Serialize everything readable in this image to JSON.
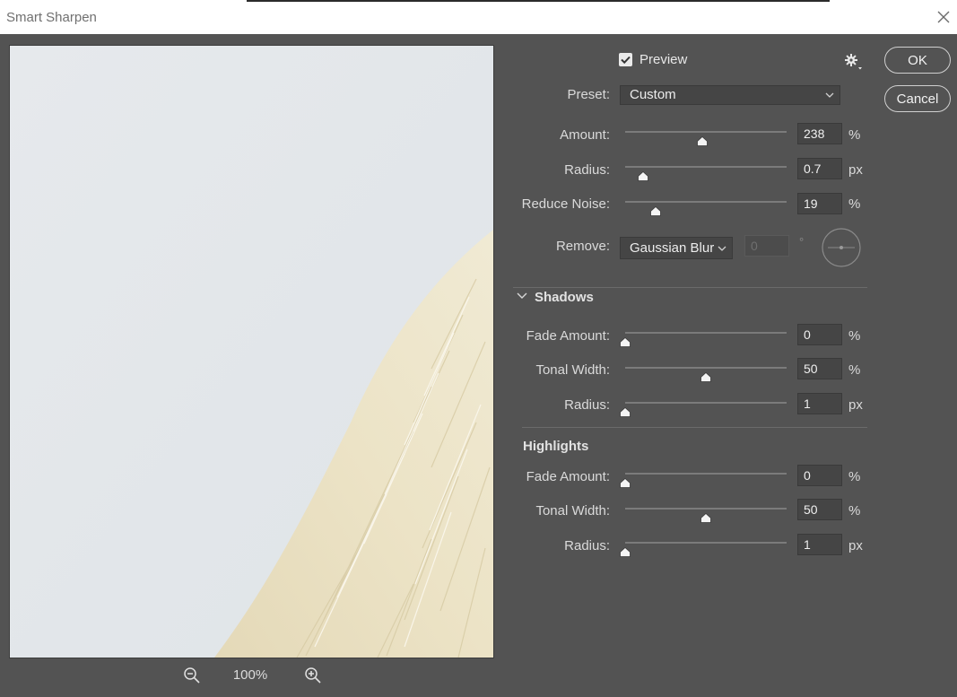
{
  "window": {
    "title": "Smart Sharpen"
  },
  "preview": {
    "label": "Preview",
    "checked": true
  },
  "buttons": {
    "ok": "OK",
    "cancel": "Cancel"
  },
  "zoom": {
    "value": "100%"
  },
  "preset": {
    "label": "Preset:",
    "value": "Custom"
  },
  "main": {
    "amount": {
      "label": "Amount:",
      "value": "238",
      "unit": "%",
      "level": 0.475
    },
    "radius": {
      "label": "Radius:",
      "value": "0.7",
      "unit": "px",
      "level": 0.11
    },
    "reduce_noise": {
      "label": "Reduce Noise:",
      "value": "19",
      "unit": "%",
      "level": 0.19
    }
  },
  "remove": {
    "label": "Remove:",
    "value": "Gaussian Blur",
    "angle": "0",
    "angle_unit": "°"
  },
  "shadows": {
    "title": "Shadows",
    "fade_amount": {
      "label": "Fade Amount:",
      "value": "0",
      "unit": "%",
      "level": 0.0
    },
    "tonal_width": {
      "label": "Tonal Width:",
      "value": "50",
      "unit": "%",
      "level": 0.5
    },
    "radius": {
      "label": "Radius:",
      "value": "1",
      "unit": "px",
      "level": 0.0
    }
  },
  "highlights": {
    "title": "Highlights",
    "fade_amount": {
      "label": "Fade Amount:",
      "value": "0",
      "unit": "%",
      "level": 0.0
    },
    "tonal_width": {
      "label": "Tonal Width:",
      "value": "50",
      "unit": "%",
      "level": 0.5
    },
    "radius": {
      "label": "Radius:",
      "value": "1",
      "unit": "px",
      "level": 0.0
    }
  },
  "icons": {
    "close": "close-icon",
    "gear": "gear-icon",
    "zoom_in": "zoom-in-icon",
    "zoom_out": "zoom-out-icon",
    "checkmark": "checkmark-icon",
    "chevron": "chevron-down-icon"
  },
  "colors": {
    "dialog_bg": "#535353",
    "titlebar_bg": "#ffffff",
    "field_bg": "#454545"
  }
}
